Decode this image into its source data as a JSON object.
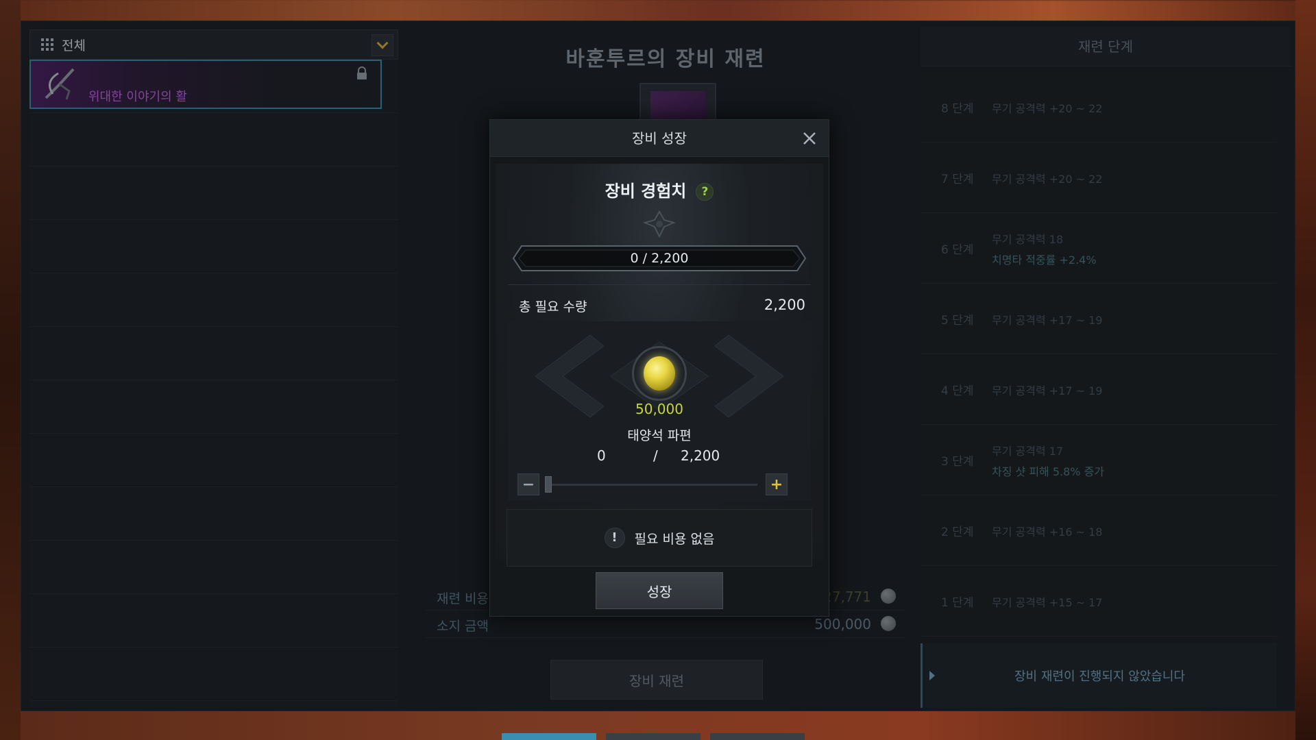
{
  "filter": {
    "label": "전체"
  },
  "item_list": {
    "selected_item": {
      "name": "위대한 이야기의 활"
    },
    "row_count": 10
  },
  "center": {
    "title": "바훈투르의 장비 재련",
    "cost_label": "재련 비용",
    "cost_value": "27,771",
    "owned_label": "소지 금액",
    "owned_value": "500,000",
    "refine_button": "장비 재련"
  },
  "right": {
    "header": "재련 단계",
    "stages": [
      {
        "num": "8 단계",
        "lines": [
          {
            "text": "무기 공격력 +20 ~ 22",
            "hl": false
          }
        ]
      },
      {
        "num": "7 단계",
        "lines": [
          {
            "text": "무기 공격력 +20 ~ 22",
            "hl": false
          }
        ]
      },
      {
        "num": "6 단계",
        "lines": [
          {
            "text": "무기 공격력 18",
            "hl": false
          },
          {
            "text": "치명타 적중률 +2.4%",
            "hl": true
          }
        ]
      },
      {
        "num": "5 단계",
        "lines": [
          {
            "text": "무기 공격력 +17 ~ 19",
            "hl": false
          }
        ]
      },
      {
        "num": "4 단계",
        "lines": [
          {
            "text": "무기 공격력 +17 ~ 19",
            "hl": false
          }
        ]
      },
      {
        "num": "3 단계",
        "lines": [
          {
            "text": "무기 공격력 17",
            "hl": false
          },
          {
            "text": "차징 샷 피해 5.8% 증가",
            "hl": true
          }
        ]
      },
      {
        "num": "2 단계",
        "lines": [
          {
            "text": "무기 공격력 +16 ~ 18",
            "hl": false
          }
        ]
      },
      {
        "num": "1 단계",
        "lines": [
          {
            "text": "무기 공격력 +15 ~ 17",
            "hl": false
          }
        ]
      }
    ],
    "status": "장비 재련이 진행되지 않았습니다"
  },
  "modal": {
    "title": "장비 성장",
    "exp_title": "장비 경험치",
    "help_glyph": "?",
    "exp_bar": "0 / 2,200",
    "total_label": "총 필요 수량",
    "total_value": "2,200",
    "material": {
      "count": "50,000",
      "name": "태양석 파편",
      "current": "0",
      "separator": "/",
      "max": "2,200"
    },
    "minus_glyph": "−",
    "plus_glyph": "+",
    "warn_glyph": "!",
    "no_cost_text": "필요 비용 없음",
    "grow_button": "성장"
  },
  "colors": {
    "accent_gold": "#d9b23a",
    "item_purple": "#c862e8",
    "material_yellow": "#c7d63c",
    "selection_border": "#3e8db0",
    "status_blue": "#7aa7c4"
  }
}
